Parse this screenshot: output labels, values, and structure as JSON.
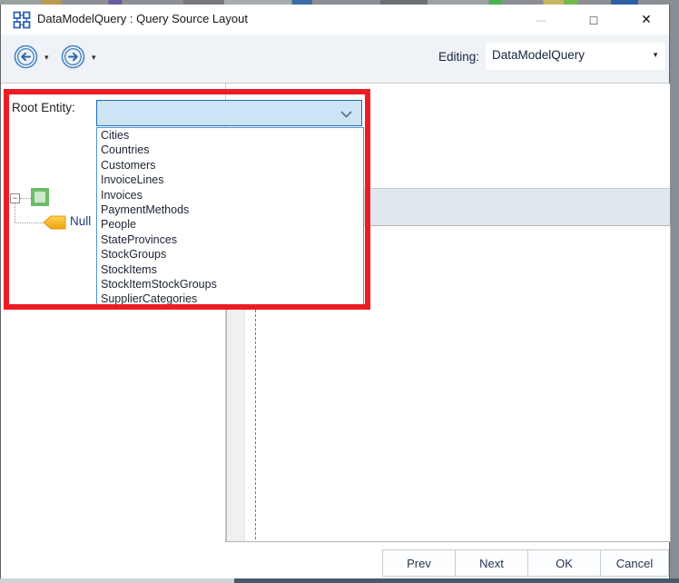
{
  "window": {
    "title": "DataModelQuery : Query Source Layout",
    "minimize_glyph": "—",
    "maximize_glyph": "□",
    "close_glyph": "✕"
  },
  "toolbar": {
    "back_caret": "▾",
    "forward_caret": "▾",
    "editing_label": "Editing:",
    "editing_value": "DataModelQuery",
    "editing_caret": "▼"
  },
  "query_form": {
    "root_entity_label": "Root Entity:",
    "root_entity_value": "",
    "root_entity_options": [
      "Cities",
      "Countries",
      "Customers",
      "InvoiceLines",
      "Invoices",
      "PaymentMethods",
      "People",
      "StateProvinces",
      "StockGroups",
      "StockItems",
      "StockItemStockGroups",
      "SupplierCategories"
    ],
    "tree": {
      "collapse_glyph": "−",
      "null_node_label": "Null"
    }
  },
  "footer": {
    "buttons": [
      "Prev",
      "Next",
      "OK",
      "Cancel"
    ]
  },
  "colors": {
    "annotation_red": "#ed1c24",
    "combo_fill": "#cde3f6",
    "combo_border": "#1f6ab5",
    "list_border": "#4f97d2",
    "header_band": "#e2e8f0",
    "toolbar_bg": "#eff3f8",
    "tree_node_green": "#6dbb6b",
    "tree_null_yellow": "#f2b222",
    "criteria_line_teal": "#2e9aa0",
    "button_text": "#23344e"
  }
}
